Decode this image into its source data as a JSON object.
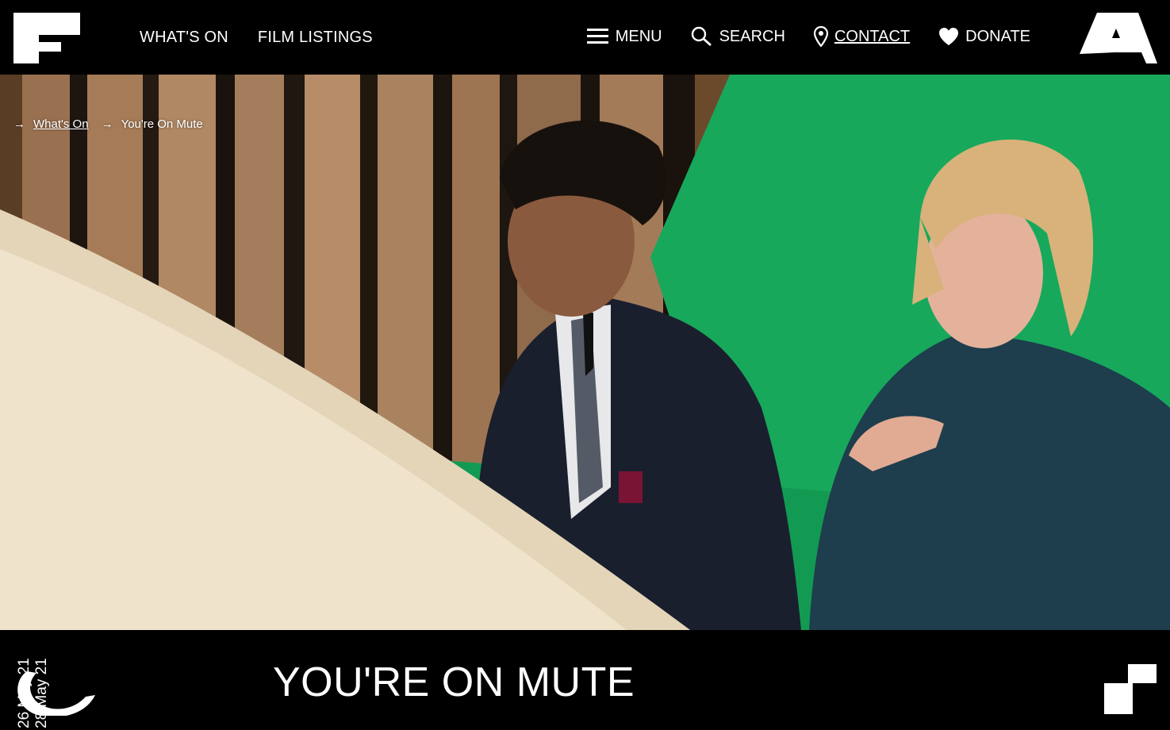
{
  "header": {
    "nav_left": [
      {
        "label": "WHAT'S ON"
      },
      {
        "label": "FILM LISTINGS"
      }
    ],
    "nav_right": [
      {
        "label": "MENU",
        "icon": "hamburger-icon"
      },
      {
        "label": "SEARCH",
        "icon": "search-icon"
      },
      {
        "label": "CONTACT",
        "icon": "location-pin-icon"
      },
      {
        "label": "DONATE",
        "icon": "heart-icon"
      }
    ]
  },
  "breadcrumb": {
    "arrow": "→",
    "items": [
      {
        "label": "What's On",
        "link": true
      },
      {
        "label": "You're On Mute",
        "link": false
      }
    ]
  },
  "event": {
    "title": "YOU'RE ON MUTE",
    "date_start": "26 May 21",
    "date_end": "28 May 21"
  },
  "colors": {
    "background": "#000000",
    "text": "#ffffff",
    "green_screen": "#17a85b"
  }
}
